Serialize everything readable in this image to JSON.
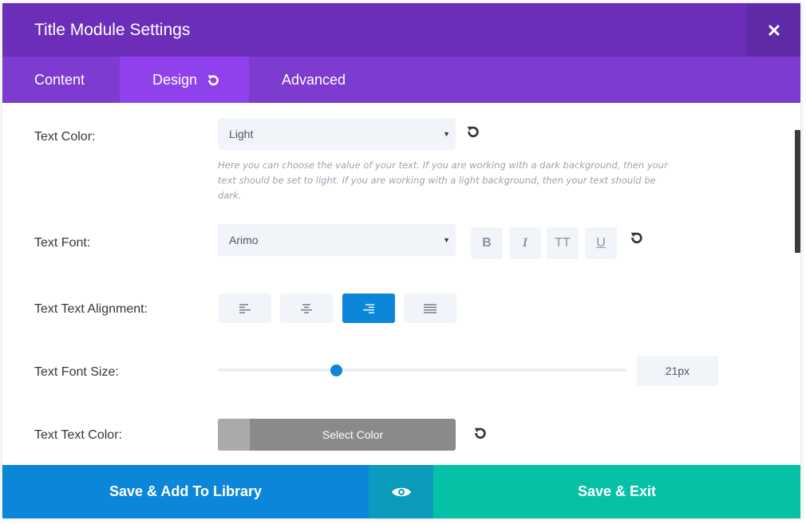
{
  "header": {
    "title": "Title Module Settings",
    "close_icon": "close-icon"
  },
  "tabs": [
    {
      "label": "Content",
      "active": false
    },
    {
      "label": "Design",
      "active": true,
      "icon": "undo-icon"
    },
    {
      "label": "Advanced",
      "active": false
    }
  ],
  "settings": {
    "text_color": {
      "label": "Text Color:",
      "value": "Light",
      "description": "Here you can choose the value of your text. If you are working with a dark background, then your text should be set to light. If you are working with a light background, then your text should be dark."
    },
    "text_font": {
      "label": "Text Font:",
      "value": "Arimo",
      "format_buttons": [
        "B",
        "I",
        "TT",
        "U"
      ]
    },
    "text_alignment": {
      "label": "Text Text Alignment:",
      "options": [
        "left",
        "center",
        "right",
        "justify"
      ],
      "selected": "right"
    },
    "text_font_size": {
      "label": "Text Font Size:",
      "value": "21px",
      "slider_position": 0.29
    },
    "text_text_color": {
      "label": "Text Text Color:",
      "button_label": "Select Color"
    }
  },
  "footer": {
    "save_library_label": "Save & Add To Library",
    "preview_icon": "eye-icon",
    "save_exit_label": "Save & Exit"
  },
  "colors": {
    "header_bg": "#6c2eb9",
    "tabs_bg": "#7e3bd0",
    "active_tab_bg": "#8f42ec",
    "accent_blue": "#0c86d8",
    "teal": "#05c1a6"
  }
}
